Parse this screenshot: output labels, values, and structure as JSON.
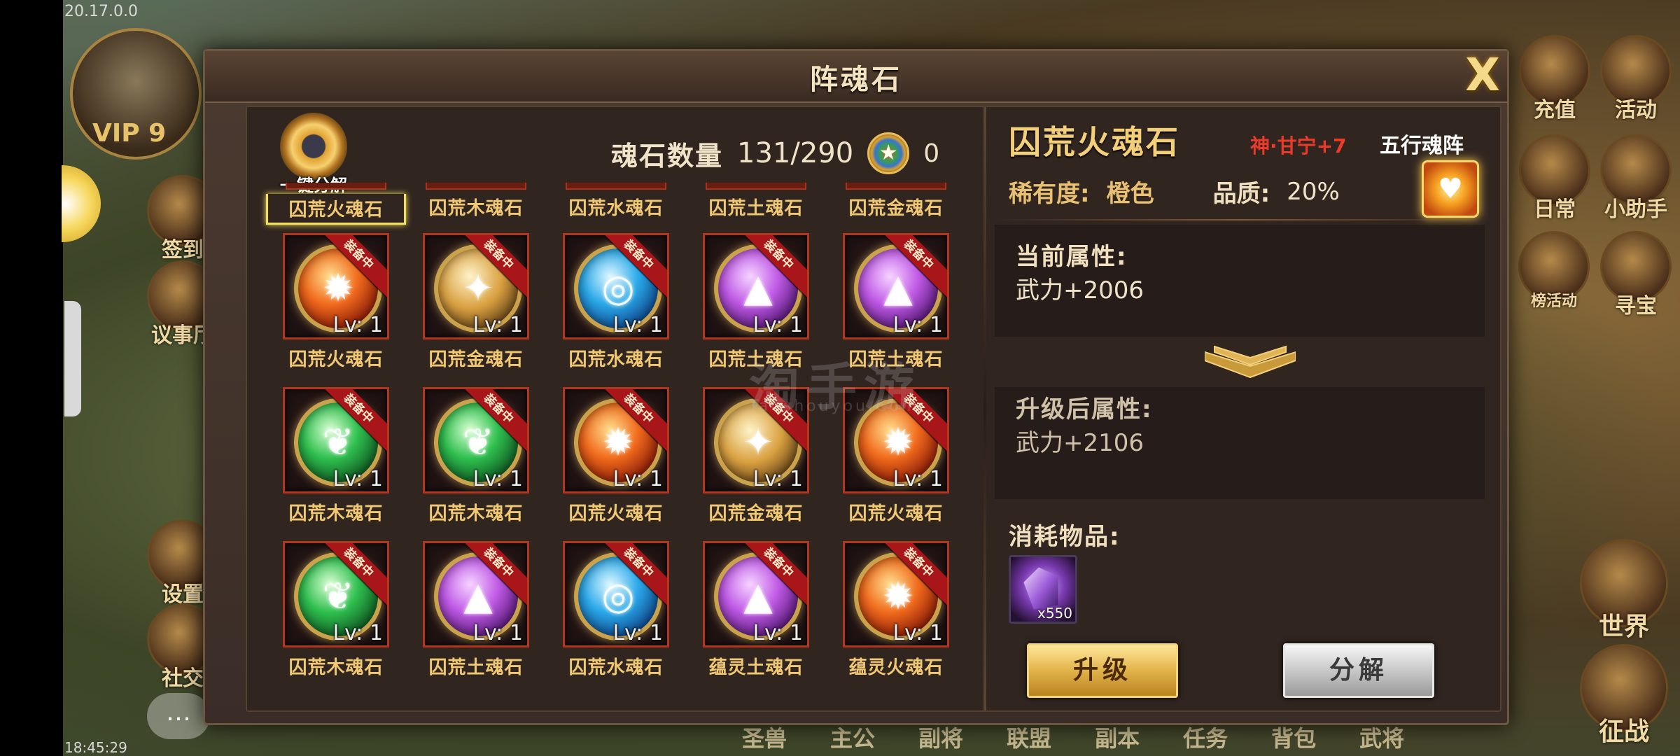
{
  "hud": {
    "version": "20.17.0.0",
    "time": "18:45:29",
    "vip": "VIP 9",
    "left_buttons": [
      "签到",
      "议事厅",
      "设置",
      "社交"
    ],
    "right_buttons": [
      "充值",
      "活动",
      "日常",
      "小助手",
      "榜活动",
      "寻宝",
      "世界",
      "征战"
    ],
    "bottom_nav": [
      "圣兽",
      "主公",
      "副将",
      "联盟",
      "副本",
      "任务",
      "背包",
      "武将"
    ]
  },
  "dialog": {
    "title": "阵魂石",
    "close": "X",
    "decompose_all_label": "一键分解",
    "count_label": "魂石数量",
    "count_value": "131/290",
    "coin_value": "0",
    "top_row_names": [
      "囚荒火魂石",
      "囚荒木魂石",
      "囚荒水魂石",
      "囚荒土魂石",
      "囚荒金魂石"
    ],
    "equipped_ribbon": "装备中",
    "stones": [
      {
        "name": "囚荒火魂石",
        "element": "fire",
        "level": "Lv: 1"
      },
      {
        "name": "囚荒金魂石",
        "element": "gold",
        "level": "Lv: 1"
      },
      {
        "name": "囚荒水魂石",
        "element": "water",
        "level": "Lv: 1"
      },
      {
        "name": "囚荒土魂石",
        "element": "earth",
        "level": "Lv: 1"
      },
      {
        "name": "囚荒土魂石",
        "element": "earth",
        "level": "Lv: 1"
      },
      {
        "name": "囚荒木魂石",
        "element": "wood",
        "level": "Lv: 1"
      },
      {
        "name": "囚荒木魂石",
        "element": "wood",
        "level": "Lv: 1"
      },
      {
        "name": "囚荒火魂石",
        "element": "fire",
        "level": "Lv: 1"
      },
      {
        "name": "囚荒金魂石",
        "element": "gold",
        "level": "Lv: 1"
      },
      {
        "name": "囚荒火魂石",
        "element": "fire",
        "level": "Lv: 1"
      },
      {
        "name": "囚荒木魂石",
        "element": "wood",
        "level": "Lv: 1"
      },
      {
        "name": "囚荒土魂石",
        "element": "earth",
        "level": "Lv: 1"
      },
      {
        "name": "囚荒水魂石",
        "element": "water",
        "level": "Lv: 1"
      },
      {
        "name": "蕴灵土魂石",
        "element": "earth",
        "level": "Lv: 1"
      },
      {
        "name": "蕴灵火魂石",
        "element": "fire",
        "level": "Lv: 1"
      }
    ],
    "detail": {
      "title": "囚荒火魂石",
      "hero_tag": "神·甘宁+7",
      "formation_tag": "五行魂阵",
      "rarity_label": "稀有度:",
      "rarity_value": "橙色",
      "quality_label": "品质:",
      "quality_value": "20%",
      "current_attr_label": "当前属性:",
      "current_attr_value": "武力+2006",
      "next_attr_label": "升级后属性:",
      "next_attr_value": "武力+2106",
      "cost_label": "消耗物品:",
      "cost_qty": "x550",
      "upgrade_button": "升级",
      "decompose_button": "分解"
    }
  },
  "watermark": {
    "big": "淘手游",
    "small": "Taoshouyou.Com"
  },
  "colors": {
    "gold_text": "#f0c874",
    "hero_tag": "#ea3a2a",
    "ribbon": "#a8161a",
    "frame_border": "#b2361d"
  }
}
